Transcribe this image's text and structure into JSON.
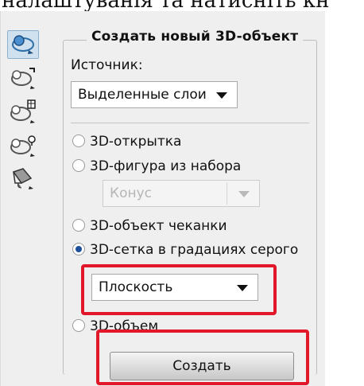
{
  "top_text": "налаштуванія та натисніть кн",
  "dialog": {
    "group_title": "Создать новый 3D-объект",
    "source_label": "Источник:",
    "source_select_value": "Выделенные слои",
    "options": [
      {
        "label": "3D-открытка",
        "checked": false
      },
      {
        "label": "3D-фигура из набора",
        "checked": false
      },
      {
        "label": "3D-объект чеканки",
        "checked": false
      },
      {
        "label": "3D-сетка в градациях серого",
        "checked": true
      },
      {
        "label": "3D-объем",
        "checked": false
      }
    ],
    "preset_select_value": "Конус",
    "mesh_select_value": "Плоскость",
    "create_button": "Создать"
  },
  "toolbar": {
    "tools": [
      "3d-object-tool-icon",
      "3d-rotate-tool-icon",
      "3d-mesh-tool-icon",
      "3d-light-tool-icon",
      "3d-material-tool-icon"
    ],
    "selected_index": 0
  },
  "colors": {
    "highlight": "#e0182a",
    "radio_checked": "#1d4f9a",
    "panel_bg": "#efefef"
  }
}
